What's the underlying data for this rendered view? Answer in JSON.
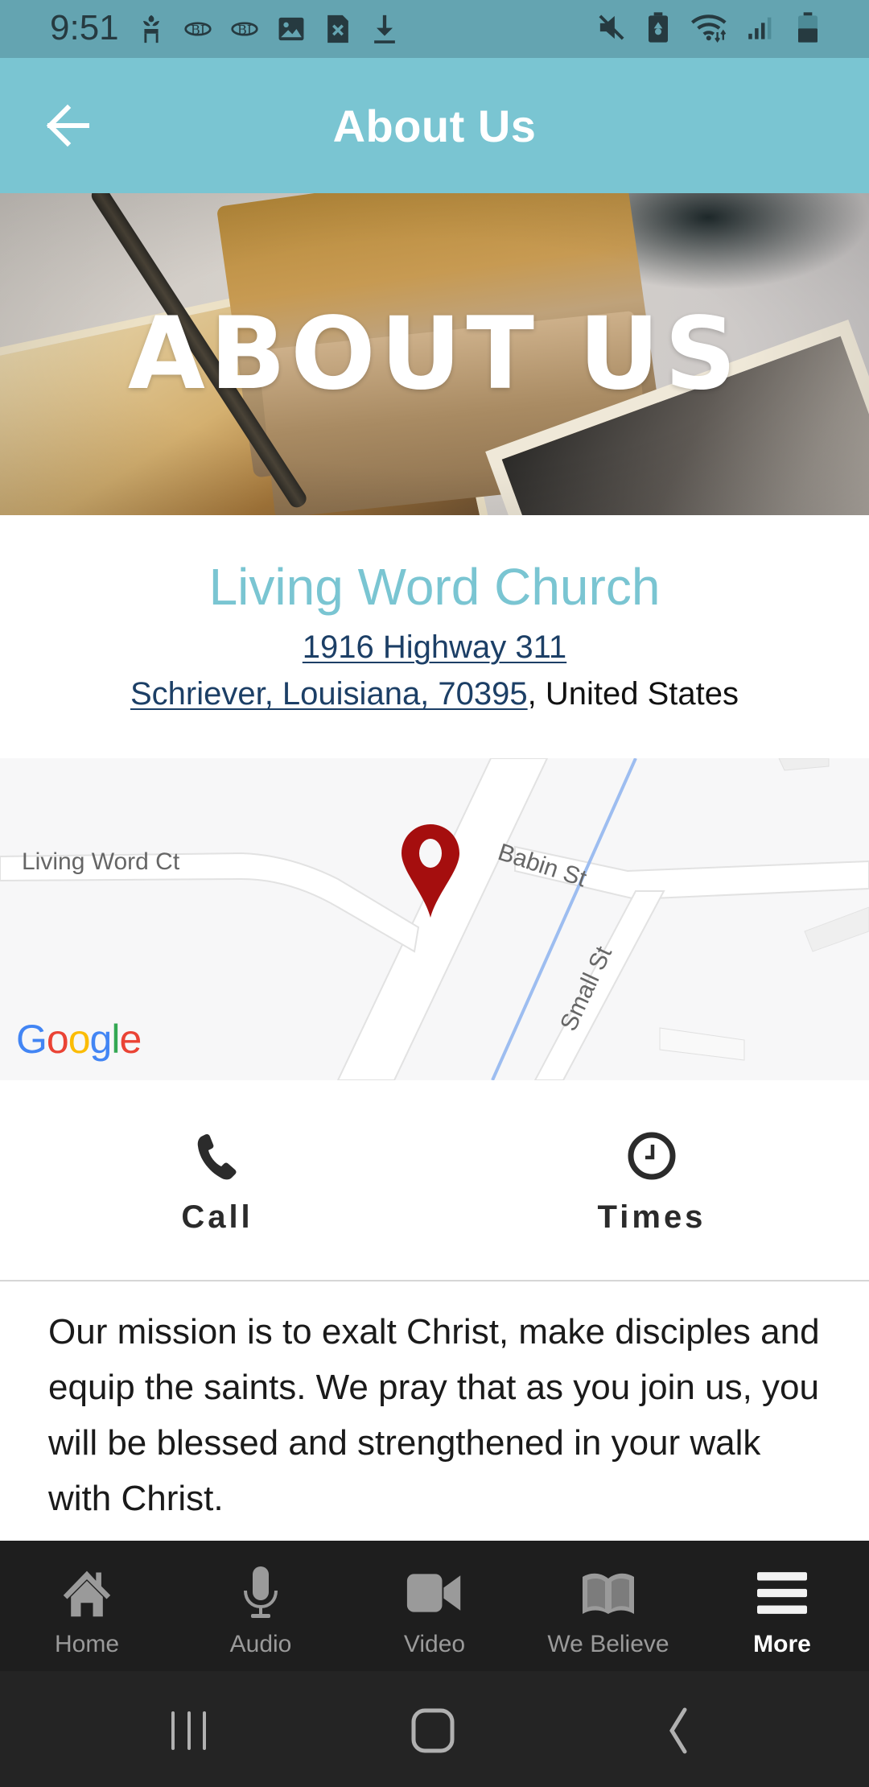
{
  "status_bar": {
    "time": "9:51",
    "left_icons": [
      "plant-notification-icon",
      "sync-notification-icon",
      "sync-notification-icon",
      "image-notification-icon",
      "sim-error-icon",
      "download-icon"
    ],
    "right_icons": [
      "mute-icon",
      "battery-saver-icon",
      "wifi-icon",
      "signal-icon",
      "battery-icon"
    ]
  },
  "app_bar": {
    "title": "About Us",
    "back_icon": "arrow-left-icon"
  },
  "hero": {
    "title": "ABOUT US"
  },
  "info": {
    "church_name": "Living Word Church",
    "address_line1": "1916 Highway 311",
    "address_line2_link": "Schriever, Louisiana, 70395",
    "address_line2_rest": ", United States"
  },
  "map": {
    "labels": {
      "living_word_ct": "Living Word Ct",
      "babin_st": "Babin St",
      "small_st": "Small St"
    },
    "logo": [
      "G",
      "o",
      "o",
      "g",
      "l",
      "e"
    ],
    "pin_color": "#a50e0e"
  },
  "actions": [
    {
      "label": "Call",
      "icon": "phone-icon"
    },
    {
      "label": "Times",
      "icon": "clock-icon"
    }
  ],
  "mission": {
    "text": "Our mission is to exalt Christ, make disciples and equip the saints. We pray that as you join us, you will be blessed and strengthened in your walk with Christ."
  },
  "bottom_nav": {
    "items": [
      {
        "label": "Home",
        "icon": "home-icon",
        "active": false
      },
      {
        "label": "Audio",
        "icon": "microphone-icon",
        "active": false
      },
      {
        "label": "Video",
        "icon": "video-camera-icon",
        "active": false
      },
      {
        "label": "We Believe",
        "icon": "open-book-icon",
        "active": false
      },
      {
        "label": "More",
        "icon": "menu-icon",
        "active": true
      }
    ]
  },
  "system_nav": {
    "buttons": [
      "recents-icon",
      "home-button-icon",
      "back-chevron-icon"
    ]
  },
  "colors": {
    "status_bar": "#64a4b1",
    "accent": "#7ac5d2",
    "link": "#1c3f66",
    "nav_bg": "#1e1e1e",
    "sys_nav_bg": "#242424"
  }
}
